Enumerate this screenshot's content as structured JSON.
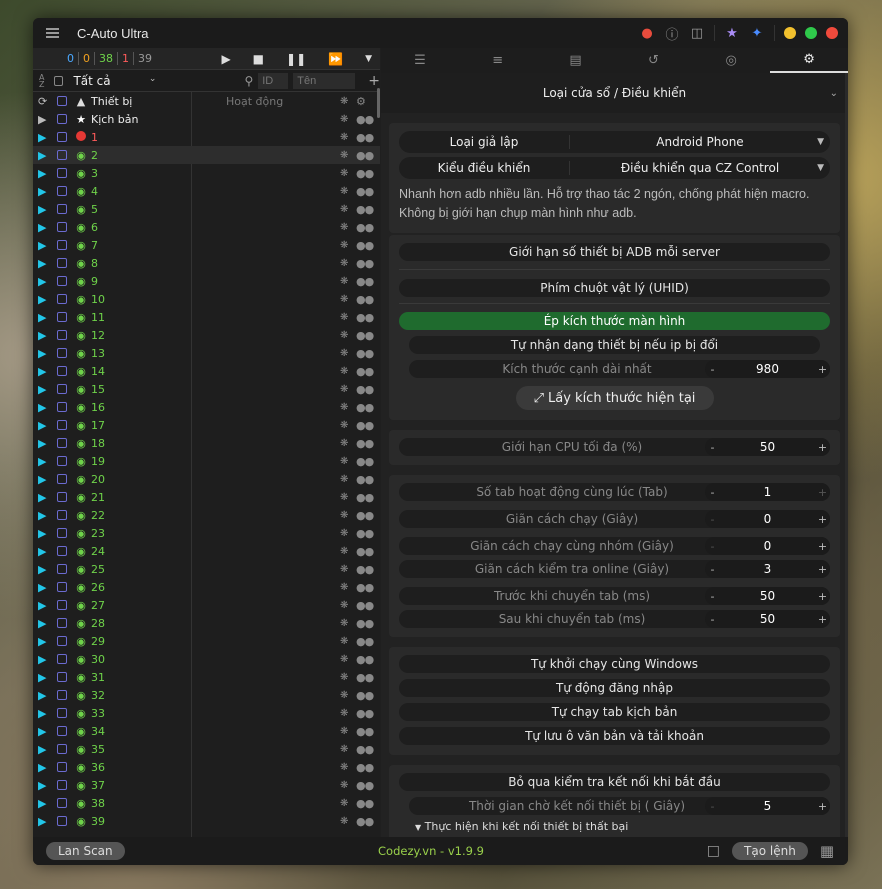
{
  "app": {
    "title": "C-Auto Ultra"
  },
  "counters": {
    "c0": "0",
    "c1": "0",
    "c2": "38",
    "c3": "1",
    "c4": "39"
  },
  "filter": {
    "all_label": "Tất cả",
    "id_placeholder": "ID",
    "name_placeholder": "Tên"
  },
  "tree": {
    "devices_label": "Thiết bị",
    "status_header": "Hoạt động",
    "scripts_label": "Kịch bản"
  },
  "devices": [
    "1",
    "2",
    "3",
    "4",
    "5",
    "6",
    "7",
    "8",
    "9",
    "10",
    "11",
    "12",
    "13",
    "14",
    "15",
    "16",
    "17",
    "18",
    "19",
    "20",
    "21",
    "22",
    "23",
    "24",
    "25",
    "26",
    "27",
    "28",
    "29",
    "30",
    "31",
    "32",
    "33",
    "34",
    "35",
    "36",
    "37",
    "38",
    "39"
  ],
  "colors": {
    "accent_green": "#6fd34a",
    "counter_blue": "#4aa8ff",
    "counter_orange": "#f0a020",
    "counter_red": "#ff5b5b",
    "play_cyan": "#22c6e8",
    "offline_red": "#e53935"
  },
  "settings": {
    "section_title": "Loại cửa sổ / Điều khiển",
    "emulator_key": "Loại giả lập",
    "emulator_value": "Android Phone",
    "control_key": "Kiểu điều khiển",
    "control_value": "Điều khiển qua CZ Control",
    "description": "Nhanh hơn adb nhiều lần. Hỗ trợ thao tác 2 ngón, chống phát hiện macro. Không bị giới hạn chụp màn hình như adb.",
    "adb_limit": "Giới hạn số thiết bị ADB mỗi server",
    "uhid": "Phím chuột vật lý (UHID)",
    "force_size": "Ép kích thước màn hình",
    "auto_detect": "Tự nhận dạng thiết bị nếu ip bị đổi",
    "long_edge_label": "Kích thước cạnh dài nhất",
    "long_edge_value": "980",
    "get_size_button": "Lấy kích thước hiện tại",
    "cpu_label": "Giới hạn CPU tối đa (%)",
    "cpu_value": "50",
    "tabs_label": "Số tab hoạt động cùng lúc (Tab)",
    "tabs_value": "1",
    "interval_label": "Giãn cách chạy (Giây)",
    "interval_value": "0",
    "group_interval_label": "Giãn cách chạy cùng nhóm (Giây)",
    "group_interval_value": "0",
    "online_check_label": "Giãn cách kiểm tra online (Giây)",
    "online_check_value": "3",
    "before_switch_label": "Trước khi chuyển tab (ms)",
    "before_switch_value": "50",
    "after_switch_label": "Sau khi chuyển tab (ms)",
    "after_switch_value": "50",
    "autostart": "Tự khởi chạy cùng Windows",
    "autologin": "Tự động đăng nhập",
    "autorun_tab": "Tự chạy tab kịch bản",
    "autosave": "Tự lưu ô văn bản và tải khoản",
    "skip_check": "Bỏ qua kiểm tra kết nối khi bắt đầu",
    "wait_conn_label": "Thời gian chờ kết nối thiết bị ( Giây)",
    "wait_conn_value": "5",
    "cut_off_text": "Thực hiện khi kết nối thiết bị thất bại"
  },
  "footer": {
    "lan_scan": "Lan Scan",
    "version": "Codezy.vn - v1.9.9",
    "create_cmd": "Tạo lệnh"
  }
}
